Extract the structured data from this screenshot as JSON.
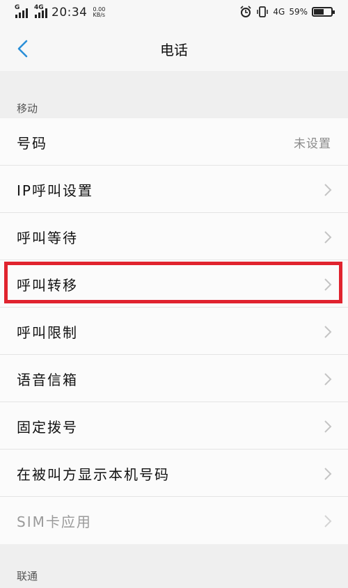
{
  "status_bar": {
    "sim1_tag": "G",
    "sim2_tag": "4G",
    "time": "20:34",
    "speed_value": "0.00",
    "speed_unit": "KB/s",
    "network_label": "4G",
    "battery_percent": "59%",
    "battery_level": 0.59
  },
  "nav": {
    "title": "电话"
  },
  "sections": [
    {
      "label": "移动",
      "items": [
        {
          "label": "号码",
          "value": "未设置"
        },
        {
          "label": "IP呼叫设置"
        },
        {
          "label": "呼叫等待"
        },
        {
          "label": "呼叫转移",
          "highlighted": true
        },
        {
          "label": "呼叫限制"
        },
        {
          "label": "语音信箱"
        },
        {
          "label": "固定拨号"
        },
        {
          "label": "在被叫方显示本机号码"
        },
        {
          "label": "SIM卡应用",
          "disabled": true
        }
      ]
    },
    {
      "label": "联通",
      "items": []
    }
  ],
  "colors": {
    "accent": "#2a8fd8",
    "highlight": "#e0232e",
    "background": "#efefef"
  }
}
